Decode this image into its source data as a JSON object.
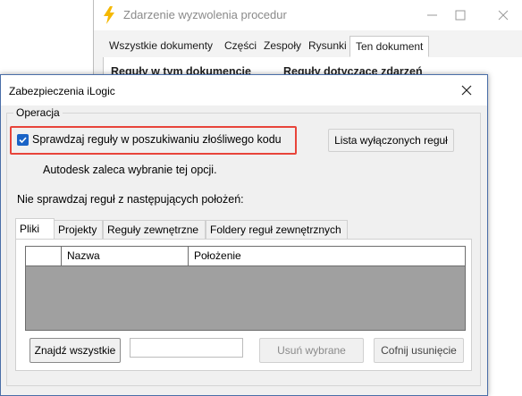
{
  "background_window": {
    "title": "Zdarzenie wyzwolenia procedur",
    "tabs": [
      {
        "label": "Wszystkie dokumenty"
      },
      {
        "label": "Części"
      },
      {
        "label": "Zespoły"
      },
      {
        "label": "Rysunki"
      },
      {
        "label": "Ten dokument",
        "active": true
      }
    ],
    "column_headers": [
      "Reguły w tym dokumencie",
      "Reguły dotyczące zdarzeń"
    ]
  },
  "dialog": {
    "title": "Zabezpieczenia iLogic",
    "group_label": "Operacja",
    "checkbox": {
      "label": "Sprawdzaj reguły w poszukiwaniu złośliwego kodu",
      "checked": true
    },
    "lista_button": "Lista wyłączonych reguł",
    "recommendation": "Autodesk zaleca wybranie tej opcji.",
    "exclusions_label": "Nie sprawdzaj reguł z następujących położeń:",
    "tabs": [
      {
        "label": "Pliki",
        "active": true
      },
      {
        "label": "Projekty"
      },
      {
        "label": "Reguły zewnętrzne"
      },
      {
        "label": "Foldery reguł zewnętrznych"
      }
    ],
    "table": {
      "columns": [
        "",
        "Nazwa",
        "Położenie"
      ],
      "rows": []
    },
    "find_all_button": "Znajdź wszystkie",
    "search_value": "",
    "remove_button": "Usuń wybrane",
    "undo_button": "Cofnij usunięcie"
  },
  "colors": {
    "checkbox_accent": "#1a63c6",
    "highlight": "#e8443a",
    "bolt_icon": "#f5b800",
    "grid_fill": "#a0a0a0"
  },
  "icons": [
    "lightning-bolt-icon",
    "minimize-icon",
    "maximize-icon",
    "close-icon",
    "checkmark-icon"
  ]
}
